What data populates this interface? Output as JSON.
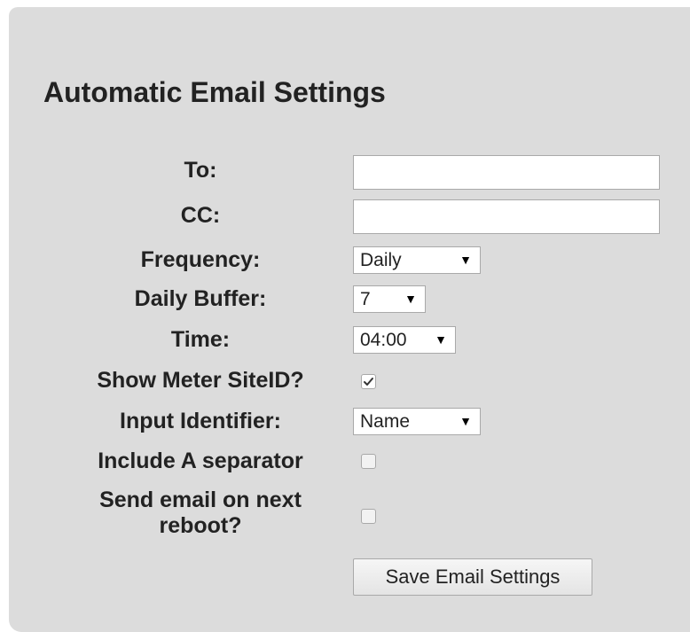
{
  "title": "Automatic Email Settings",
  "fields": {
    "to": {
      "label": "To:",
      "value": ""
    },
    "cc": {
      "label": "CC:",
      "value": ""
    },
    "frequency": {
      "label": "Frequency:",
      "selected": "Daily"
    },
    "daily_buffer": {
      "label": "Daily Buffer:",
      "selected": "7"
    },
    "time": {
      "label": "Time:",
      "selected": "04:00"
    },
    "show_meter_siteid": {
      "label": "Show Meter SiteID?",
      "checked": true
    },
    "input_identifier": {
      "label": "Input Identifier:",
      "selected": "Name"
    },
    "include_separator": {
      "label": "Include A separator",
      "checked": false
    },
    "send_on_reboot": {
      "label": "Send email on next reboot?",
      "checked": false
    }
  },
  "save_button_label": "Save Email Settings",
  "icons": {
    "dropdown": "dropdown-arrow-icon",
    "check": "checkmark-icon"
  },
  "colors": {
    "panel_background": "#dcdcdc",
    "text": "#222222",
    "border": "#a9a9a9"
  }
}
